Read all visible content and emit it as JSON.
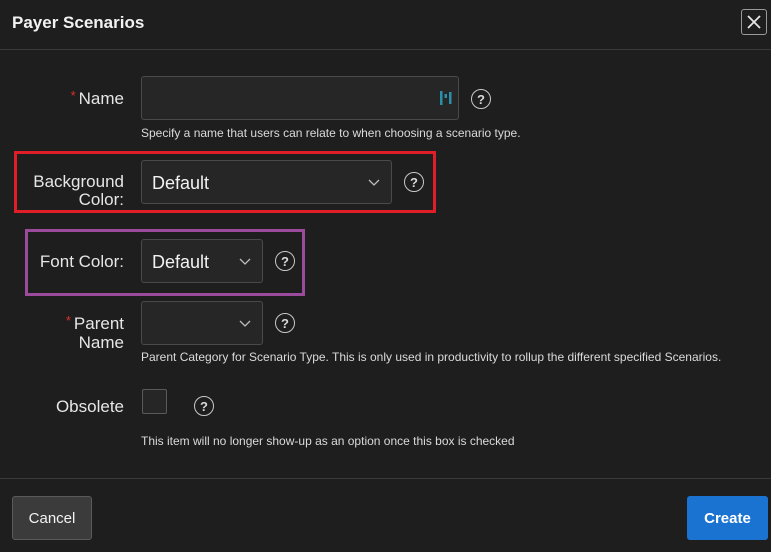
{
  "dialog": {
    "title": "Payer Scenarios",
    "close_icon": "close-icon"
  },
  "form": {
    "name": {
      "required_marker": "*",
      "label": "Name",
      "value": "",
      "hint": "Specify a name that users can relate to when choosing a scenario type.",
      "inline_icon": "field-assist-icon"
    },
    "background_color": {
      "label_line1": "Background",
      "label_line2": "Color:",
      "value": "Default"
    },
    "font_color": {
      "label": "Font Color:",
      "value": "Default"
    },
    "parent_name": {
      "required_marker": "*",
      "label_line1": "Parent",
      "label_line2": "Name",
      "value": "",
      "hint": "Parent Category for Scenario Type. This is only used in productivity to rollup the different specified Scenarios."
    },
    "obsolete": {
      "label": "Obsolete",
      "checked": false,
      "hint": "This item will no longer show-up as an option once this box is checked"
    },
    "help_glyph": "?"
  },
  "footer": {
    "cancel_label": "Cancel",
    "create_label": "Create"
  },
  "colors": {
    "required": "#e0302c",
    "primary_button": "#1b73d1",
    "highlight_red": "#e01e28",
    "highlight_purple": "#9b4a9c"
  }
}
